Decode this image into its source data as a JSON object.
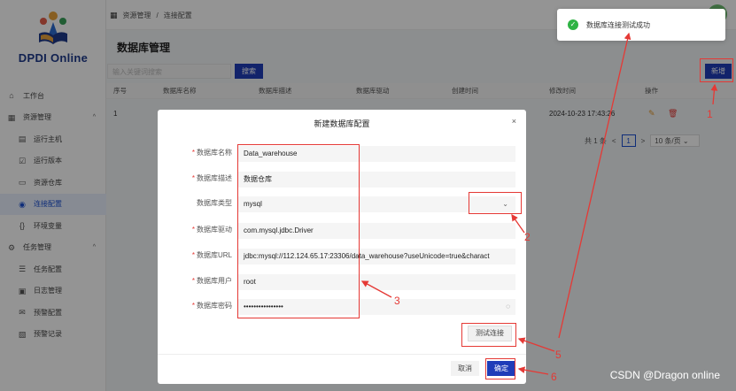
{
  "app": {
    "logo_text": "DPDI Online"
  },
  "breadcrumb": [
    "资源管理",
    "连接配置"
  ],
  "page_title": "数据库管理",
  "sidebar": {
    "items": [
      {
        "label": "工作台",
        "icon": "home-icon",
        "level": "top"
      },
      {
        "label": "资源管理",
        "icon": "grid-icon",
        "level": "top",
        "caret": "^"
      },
      {
        "label": "运行主机",
        "icon": "server-icon",
        "level": "sub"
      },
      {
        "label": "运行版本",
        "icon": "version-icon",
        "level": "sub"
      },
      {
        "label": "资源仓库",
        "icon": "folder-icon",
        "level": "sub"
      },
      {
        "label": "连接配置",
        "icon": "database-icon",
        "level": "sub",
        "active": true
      },
      {
        "label": "环境变量",
        "icon": "braces-icon",
        "level": "sub"
      },
      {
        "label": "任务管理",
        "icon": "gear-icon",
        "level": "top",
        "caret": "^"
      },
      {
        "label": "任务配置",
        "icon": "list-icon",
        "level": "sub"
      },
      {
        "label": "日志管理",
        "icon": "log-icon",
        "level": "sub"
      },
      {
        "label": "预警配置",
        "icon": "mail-icon",
        "level": "sub"
      },
      {
        "label": "预警记录",
        "icon": "record-icon",
        "level": "sub"
      }
    ]
  },
  "toolbar": {
    "search_placeholder": "输入关键词搜索",
    "search_label": "搜索",
    "new_label": "新增"
  },
  "table": {
    "columns": [
      "序号",
      "数据库名称",
      "数据库描述",
      "数据库驱动",
      "创建时间",
      "修改时间",
      "操作"
    ],
    "rows": [
      {
        "index": "1",
        "modified": "2024-10-23 17:43:26"
      }
    ]
  },
  "pager": {
    "total": "共 1 条",
    "prev": "<",
    "page": "1",
    "next": ">",
    "size": "10 条/页"
  },
  "modal": {
    "title": "新建数据库配置",
    "close": "×",
    "fields": [
      {
        "label": "数据库名称",
        "required": true,
        "value": "Data_warehouse"
      },
      {
        "label": "数据库描述",
        "required": true,
        "value": "数据仓库"
      },
      {
        "label": "数据库类型",
        "required": false,
        "value": "mysql"
      },
      {
        "label": "数据库驱动",
        "required": true,
        "value": "com.mysql.jdbc.Driver"
      },
      {
        "label": "数据库URL",
        "required": true,
        "value": "jdbc:mysql://112.124.65.17:23306/data_warehouse?useUnicode=true&charact"
      },
      {
        "label": "数据库用户",
        "required": true,
        "value": "root"
      },
      {
        "label": "数据库密码",
        "required": true,
        "value": "••••••••••••••••"
      }
    ],
    "test_label": "测试连接",
    "cancel_label": "取消",
    "ok_label": "确定"
  },
  "toast": {
    "text": "数据库连接测试成功"
  },
  "annotations": [
    "1",
    "2",
    "3",
    "5",
    "6"
  ],
  "watermark": "CSDN @Dragon online",
  "colors": {
    "primary": "#1f3db9",
    "annotation": "#e53935",
    "success": "#2fb344"
  }
}
